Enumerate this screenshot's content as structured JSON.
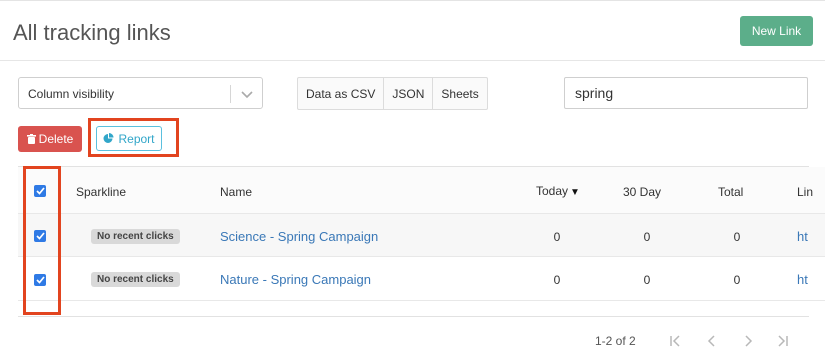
{
  "header": {
    "title": "All tracking links",
    "new_link_label": "New Link"
  },
  "toolbar": {
    "column_visibility_label": "Column visibility",
    "export_buttons": [
      "Data as CSV",
      "JSON",
      "Sheets"
    ],
    "search_value": "spring",
    "delete_label": "Delete",
    "report_label": "Report"
  },
  "table": {
    "columns": {
      "sparkline": "Sparkline",
      "name": "Name",
      "today": "Today",
      "thirty_day": "30 Day",
      "total": "Total",
      "link": "Lin"
    },
    "sort_indicator": "▼",
    "rows": [
      {
        "checked": true,
        "sparkline": "No recent clicks",
        "name": "Science - Spring Campaign",
        "today": "0",
        "thirty_day": "0",
        "total": "0",
        "link": "ht"
      },
      {
        "checked": true,
        "sparkline": "No recent clicks",
        "name": "Nature - Spring Campaign",
        "today": "0",
        "thirty_day": "0",
        "total": "0",
        "link": "ht"
      }
    ]
  },
  "pagination": {
    "info": "1-2 of 2"
  },
  "colors": {
    "accent_green": "#5cae8a",
    "danger_red": "#d9534f",
    "info_blue": "#5bc0de",
    "highlight": "#e2441f",
    "checkbox_blue": "#2f7ae5",
    "link_blue": "#3a78b7"
  }
}
